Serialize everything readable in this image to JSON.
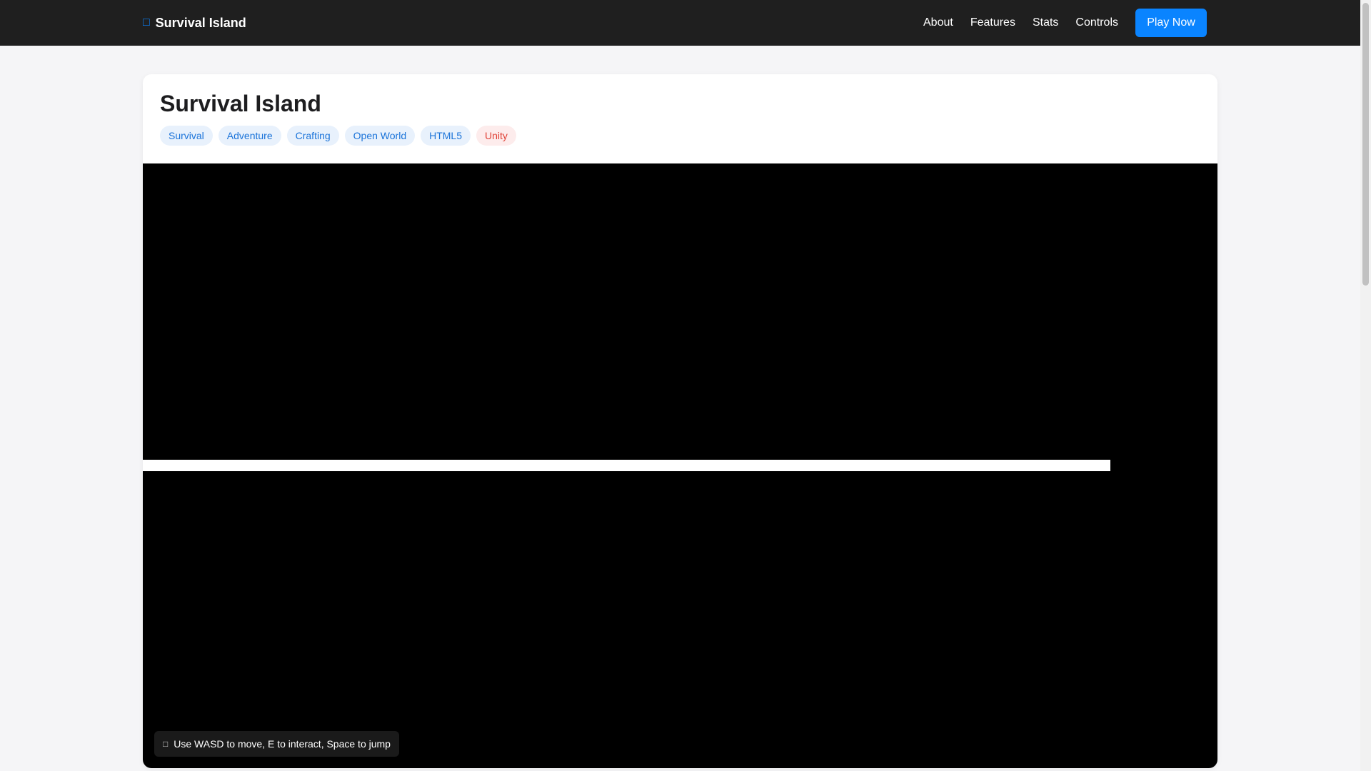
{
  "nav": {
    "brand_icon": "gamepad-icon",
    "brand_glyph": "□",
    "brand": "Survival Island",
    "links": [
      {
        "label": "About"
      },
      {
        "label": "Features"
      },
      {
        "label": "Stats"
      },
      {
        "label": "Controls"
      }
    ],
    "cta": "Play Now"
  },
  "game": {
    "title": "Survival Island",
    "tags": [
      "Survival",
      "Adventure",
      "Crafting",
      "Open World",
      "HTML5"
    ],
    "engine_tag": "Unity",
    "load_progress": 0.9,
    "hint_icon": "keyboard-icon",
    "hint_glyph": "□",
    "hint": "Use WASD to move, E to interact, Space to jump"
  },
  "colors": {
    "accent": "#0a84ff",
    "nav_bg": "#1f1f1f",
    "tag_bg": "#e8f1fc",
    "tag_text": "#1a73d9",
    "engine_tag_bg": "#fdecec",
    "engine_tag_text": "#e0453a"
  }
}
